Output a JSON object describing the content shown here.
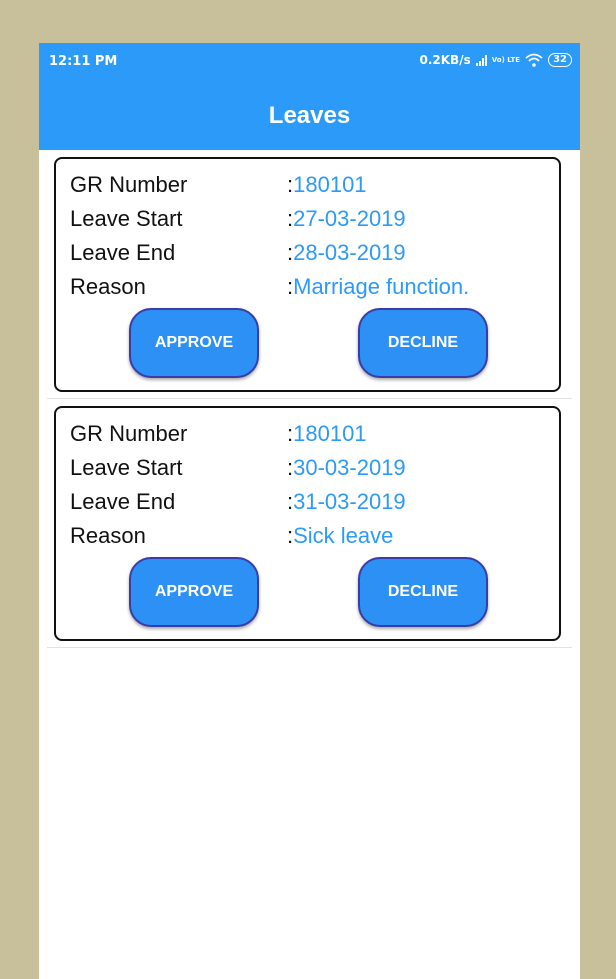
{
  "status_bar": {
    "time": "12:11 PM",
    "network_speed": "0.2KB/s",
    "volte_label": "Vo) LTE",
    "battery": "32",
    "icons": [
      "signal-icon",
      "volte-icon",
      "wifi-icon",
      "battery-icon"
    ]
  },
  "app_bar": {
    "title": "Leaves"
  },
  "labels": {
    "gr_number": "GR Number",
    "leave_start": "Leave Start",
    "leave_end": "Leave End",
    "reason": "Reason",
    "separator": ":",
    "approve": "APPROVE",
    "decline": "DECLINE"
  },
  "leaves": [
    {
      "gr_number": "180101",
      "leave_start": "27-03-2019",
      "leave_end": "28-03-2019",
      "reason": "Marriage function."
    },
    {
      "gr_number": "180101",
      "leave_start": "30-03-2019",
      "leave_end": "31-03-2019",
      "reason": "Sick leave"
    }
  ],
  "colors": {
    "accent": "#2c9af8",
    "page_background": "#c8bf9b",
    "button": "#2c90f5",
    "button_border": "#3a3da8"
  }
}
